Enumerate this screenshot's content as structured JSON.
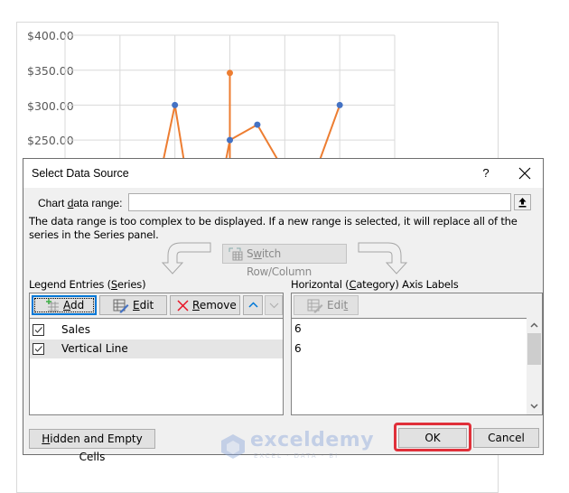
{
  "chart_data": {
    "type": "line",
    "title": "",
    "xlabel": "",
    "ylabel": "",
    "ylim": [
      200,
      400
    ],
    "y_ticks_visible": [
      "$400.00",
      "$350.00",
      "$300.00",
      "$250.00"
    ],
    "grid": true,
    "series": [
      {
        "name": "Sales",
        "color": "#4472c4",
        "marker": "circle",
        "points": [
          {
            "x": 2,
            "y": 300
          },
          {
            "x": 3,
            "y": 250
          },
          {
            "x": 3.5,
            "y": 272
          },
          {
            "x": 5,
            "y": 300
          }
        ]
      },
      {
        "name": "Vertical Line",
        "color": "#ed7d31",
        "marker": "circle",
        "points": [
          {
            "x": 3,
            "y": 346
          }
        ]
      }
    ],
    "line_color": "#ed7d31",
    "x_range": [
      0,
      6
    ]
  },
  "dialog": {
    "title": "Select Data Source",
    "help_label": "?",
    "close_label": "×",
    "chart_data_range_label_pre": "Chart ",
    "chart_data_range_label_mnemonic": "d",
    "chart_data_range_label_post": "ata range:",
    "chart_data_range_value": "",
    "info_text": "The data range is too complex to be displayed. If a new range is selected, it will replace all of the series in the Series panel.",
    "switch_label_pre": "S",
    "switch_label_mnemonic": "w",
    "switch_label_post": "itch Row/Column",
    "legend_entries": {
      "label_pre": "Legend Entries (",
      "label_mnemonic": "S",
      "label_post": "eries)",
      "add_label_mnemonic": "A",
      "add_label_post": "dd",
      "edit_label_mnemonic": "E",
      "edit_label_post": "dit",
      "remove_label_mnemonic": "R",
      "remove_label_post": "emove",
      "series": [
        {
          "label": "Sales",
          "checked": true
        },
        {
          "label": "Vertical Line",
          "checked": true,
          "selected": true
        }
      ]
    },
    "axis_labels": {
      "label_pre": "Horizontal (",
      "label_mnemonic": "C",
      "label_post": "ategory) Axis Labels",
      "edit_label_pre": "Edi",
      "edit_label_mnemonic": "t",
      "values": [
        "6",
        "6"
      ]
    },
    "hidden_cells_mnemonic": "H",
    "hidden_cells_post": "idden and Empty Cells",
    "ok_label": "OK",
    "cancel_label": "Cancel",
    "highlight_color": "#e0303a"
  },
  "watermark": {
    "brand": "exceldemy",
    "tagline": "EXCEL · DATA · BI"
  }
}
